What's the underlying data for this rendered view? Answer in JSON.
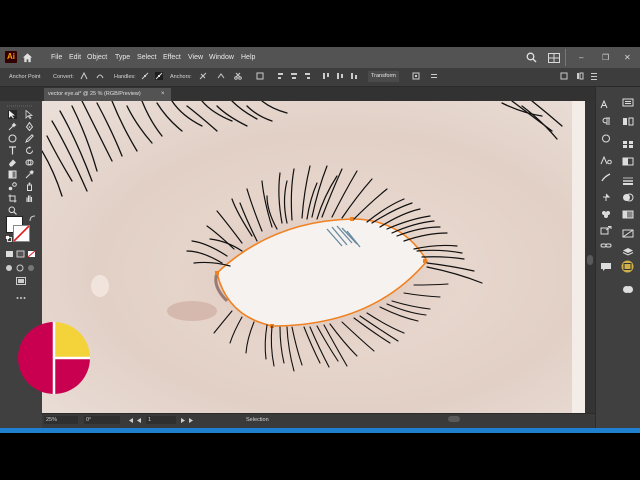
{
  "app": {
    "logo_text": "Ai"
  },
  "menu": [
    "File",
    "Edit",
    "Object",
    "Type",
    "Select",
    "Effect",
    "View",
    "Window",
    "Help"
  ],
  "control_bar": {
    "mode_label": "Anchor Point",
    "convert_label": "Convert:",
    "handles_label": "Handles:",
    "anchors_label": "Anchors:",
    "transform_label": "Transform"
  },
  "document_tab": {
    "title": "vector eye.ai* @ 25 % (RGB/Preview)",
    "close_symbol": "×"
  },
  "status_bar": {
    "zoom": "25%",
    "rotation": "0°",
    "artboard": "1",
    "tool": "Selection"
  },
  "window_controls": [
    "–",
    "❐",
    "✕"
  ],
  "icons": {
    "home": "home-icon",
    "search": "search-icon",
    "workspace": "grid-icon"
  },
  "colors": {
    "accent_blue": "#1f7fd0",
    "anchor_orange": "#f08020",
    "logo_magenta": "#c8004f",
    "logo_yellow": "#f4d23a"
  }
}
